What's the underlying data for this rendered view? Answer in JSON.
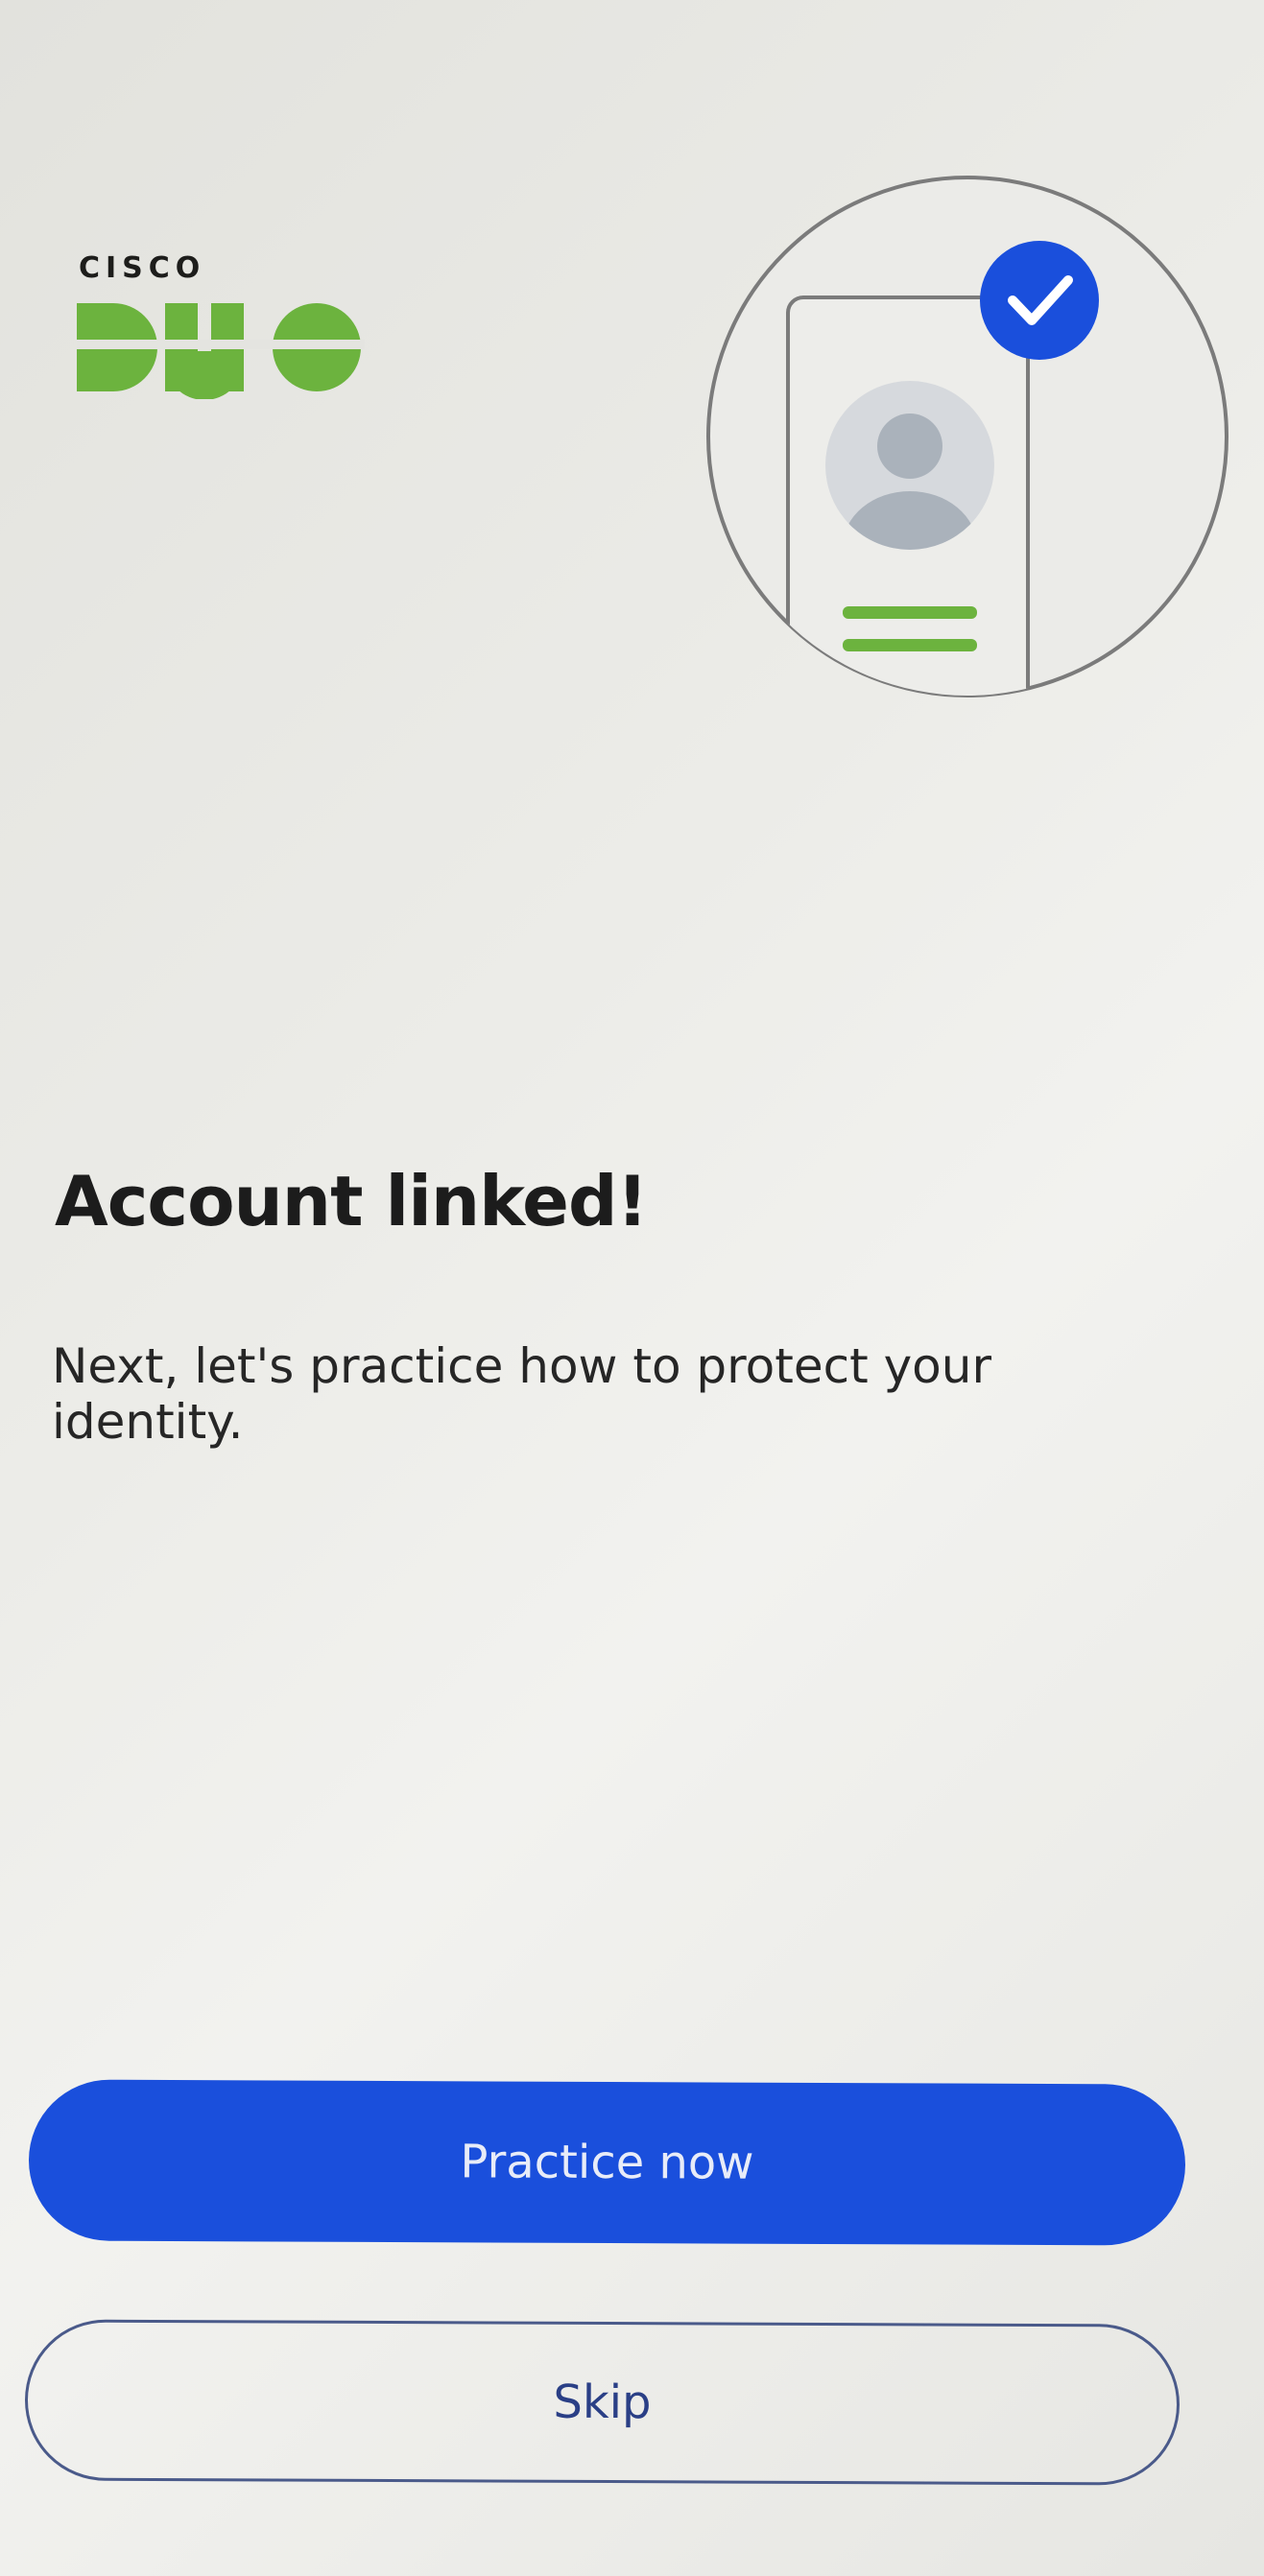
{
  "logo": {
    "company": "CISCO",
    "product": "DUO",
    "brand_color": "#6cb33e"
  },
  "illustration": {
    "icon": "phone-with-verified-user-icon",
    "check_color": "#1a4fdc",
    "accent_color": "#6cb33e"
  },
  "content": {
    "title": "Account linked!",
    "subtitle": "Next, let's practice how to protect your identity."
  },
  "actions": {
    "primary_label": "Practice now",
    "secondary_label": "Skip"
  }
}
